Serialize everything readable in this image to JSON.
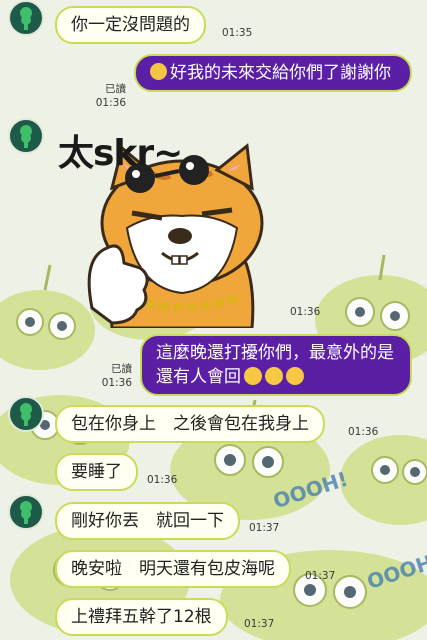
{
  "messages": [
    {
      "side": "in",
      "text": "你一定沒問題的",
      "time": "01:35"
    },
    {
      "side": "out",
      "text": "好我的未來交給你們了謝謝你",
      "read": "已讀",
      "time": "01:36",
      "emoji": "pleading-face"
    },
    {
      "side": "in",
      "type": "sticker",
      "sticker_text": "太skr~",
      "time": "01:36"
    },
    {
      "side": "out",
      "text": "這麼晚還打擾你們，最意外的是還有人會回",
      "read": "已讀",
      "time": "01:36",
      "emoji": "laughing-tears x3"
    },
    {
      "side": "in",
      "text": "包在你身上　之後會包在我身上",
      "time": "01:36"
    },
    {
      "side": "in",
      "text": "要睡了",
      "time": "01:36"
    },
    {
      "side": "in",
      "text": "剛好你丟　就回一下",
      "time": "01:37"
    },
    {
      "side": "in",
      "text": "晚安啦　明天還有包皮海呢",
      "time": "01:37"
    },
    {
      "side": "in",
      "text": "上禮拜五幹了12根",
      "time": "01:37"
    }
  ],
  "background": {
    "decor_text_1": "OOOH!",
    "decor_text_2": "OOOH"
  },
  "colors": {
    "outgoing_bubble": "#5b1fa6",
    "incoming_bubble": "#fffff2",
    "bubble_border": "#c9dc57",
    "avatar": "#1e5a48"
  }
}
